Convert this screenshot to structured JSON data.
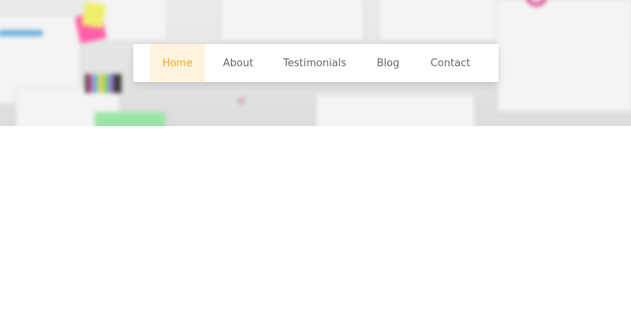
{
  "nav": {
    "items": [
      {
        "label": "Home",
        "active": true
      },
      {
        "label": "About",
        "active": false
      },
      {
        "label": "Testimonials",
        "active": false
      },
      {
        "label": "Blog",
        "active": false
      },
      {
        "label": "Contact",
        "active": false
      }
    ]
  },
  "colors": {
    "active_text": "#f5a623",
    "active_bg": "#fff3de",
    "nav_text": "#666666",
    "hero_bg": "#e6e6e6",
    "page_bg": "#ffffff"
  }
}
